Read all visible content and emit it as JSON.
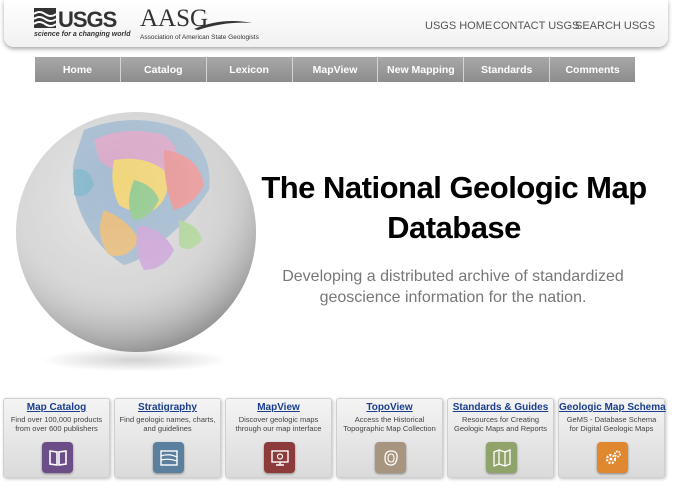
{
  "header": {
    "usgs_name": "USGS",
    "usgs_tagline": "science for a changing world",
    "aasg_name": "AASG",
    "aasg_full": "Association of American State Geologists",
    "links": [
      "USGS HOME",
      "CONTACT USGS",
      "SEARCH USGS"
    ]
  },
  "nav": [
    "Home",
    "Catalog",
    "Lexicon",
    "MapView",
    "New Mapping",
    "Standards",
    "Comments"
  ],
  "hero": {
    "title_line1": "The National Geologic Map",
    "title_line2": "Database",
    "subtitle_line1": "Developing a distributed archive of standardized",
    "subtitle_line2": "geoscience information for the nation."
  },
  "tiles": [
    {
      "title": "Map Catalog",
      "desc1": "Find over 100,000 products",
      "desc2": "from over 600 publishers",
      "icon": "book-icon",
      "color": "#6b4d87"
    },
    {
      "title": "Stratigraphy",
      "desc1": "Find geologic names, charts,",
      "desc2": "and guidelines",
      "icon": "strata-icon",
      "color": "#5b7f9e"
    },
    {
      "title": "MapView",
      "desc1": "Discover geologic maps",
      "desc2": "through our map interface",
      "icon": "map-view-icon",
      "color": "#8c3a3a"
    },
    {
      "title": "TopoView",
      "desc1": "Access the Historical",
      "desc2": "Topographic Map Collection",
      "icon": "topo-icon",
      "color": "#a89580"
    },
    {
      "title": "Standards & Guides",
      "desc1": "Resources for Creating",
      "desc2": "Geologic Maps and Reports",
      "icon": "folded-map-icon",
      "color": "#8fa36a"
    },
    {
      "title": "Geologic Map Schema",
      "desc1": "GeMS - Database Schema",
      "desc2": "for Digital Geologic Maps",
      "icon": "gears-icon",
      "color": "#e0882f"
    }
  ]
}
